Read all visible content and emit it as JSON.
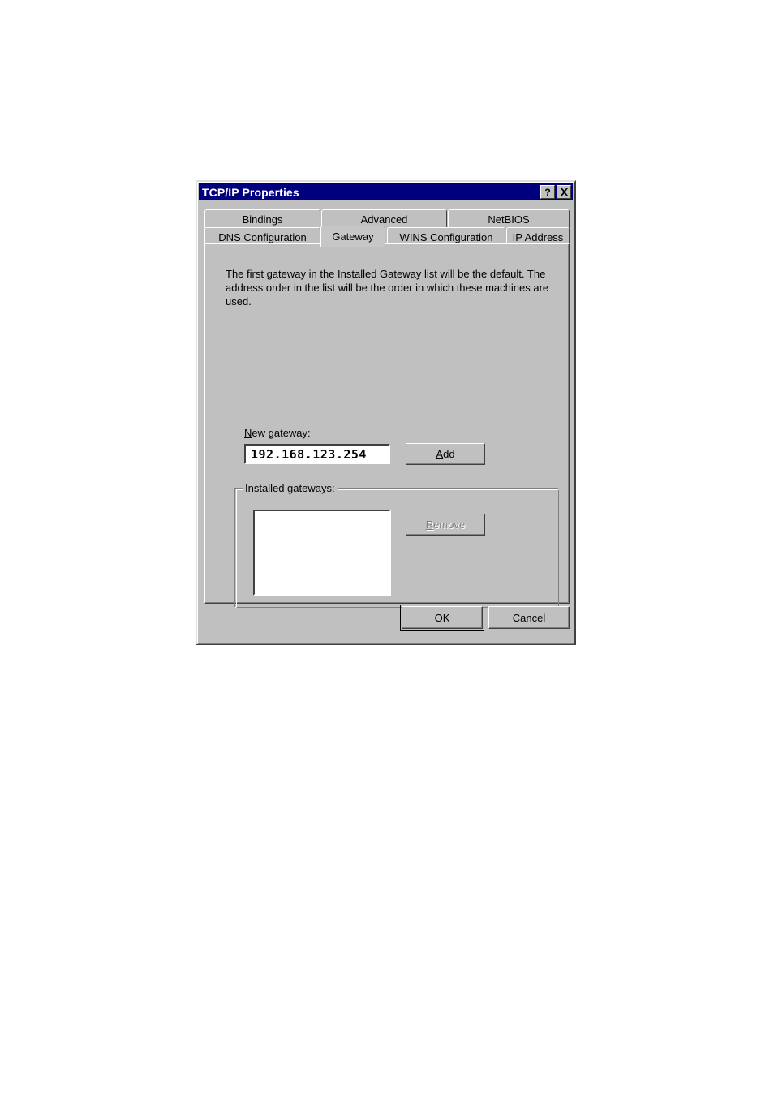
{
  "window": {
    "title": "TCP/IP Properties",
    "titlebar_color": "#00007f",
    "face_color": "#c0c0c0",
    "buttons": [
      {
        "name": "help",
        "glyph": "?"
      },
      {
        "name": "close",
        "glyph": "✕"
      }
    ]
  },
  "tabs": {
    "row1": [
      {
        "label": "Bindings",
        "selected": false
      },
      {
        "label": "Advanced",
        "selected": false
      },
      {
        "label": "NetBIOS",
        "selected": false
      }
    ],
    "row2": [
      {
        "label": "DNS Configuration",
        "selected": false
      },
      {
        "label": "Gateway",
        "selected": true
      },
      {
        "label": "WINS Configuration",
        "selected": false
      },
      {
        "label": "IP Address",
        "selected": false
      }
    ]
  },
  "page": {
    "description": "The first gateway in the Installed Gateway list will be the default. The address order in the list will be the order in which these machines are used.",
    "new_gateway": {
      "label_prefix": "",
      "label_accel": "N",
      "label_rest": "ew gateway:",
      "value": "192.168.123.254",
      "placeholder": ""
    },
    "add_button": {
      "accel": "A",
      "rest": "dd",
      "enabled": true
    },
    "installed_gateways": {
      "group_accel": "I",
      "group_rest": "nstalled gateways:",
      "items": []
    },
    "remove_button": {
      "accel": "R",
      "rest": "emove",
      "enabled": false
    }
  },
  "footer": {
    "ok_label": "OK",
    "cancel_label": "Cancel"
  }
}
